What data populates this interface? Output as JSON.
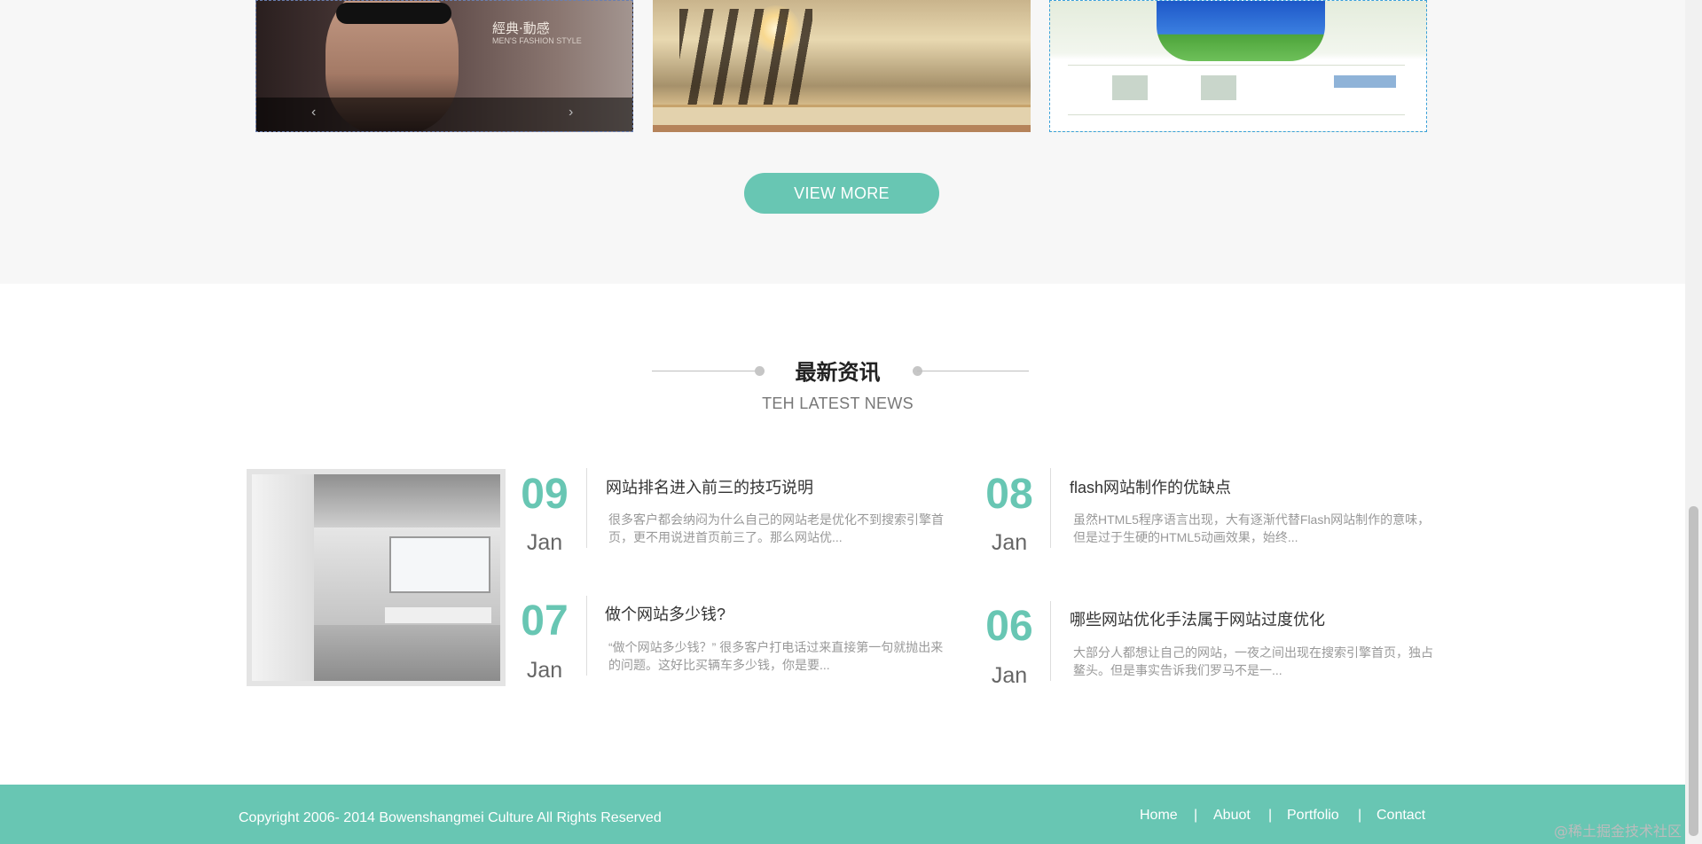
{
  "portfolio": {
    "thumb1_slogan_cn": "經典·動感",
    "thumb1_slogan_en": "MEN'S FASHION STYLE",
    "view_more_label": "VIEW MORE"
  },
  "news": {
    "title": "最新资讯",
    "subtitle": "TEH LATEST NEWS",
    "items": [
      {
        "day": "09",
        "month": "Jan",
        "title": "网站排名进入前三的技巧说明",
        "summary": "很多客户都会纳闷为什么自己的网站老是优化不到搜索引擎首页，更不用说进首页前三了。那么网站优..."
      },
      {
        "day": "08",
        "month": "Jan",
        "title": "flash网站制作的优缺点",
        "summary": "虽然HTML5程序语言出现，大有逐渐代替Flash网站制作的意味，但是过于生硬的HTML5动画效果，始终..."
      },
      {
        "day": "07",
        "month": "Jan",
        "title": "做个网站多少钱?",
        "summary": "“做个网站多少钱？” 很多客户打电话过来直接第一句就抛出来的问题。这好比买辆车多少钱，你是要..."
      },
      {
        "day": "06",
        "month": "Jan",
        "title": "哪些网站优化手法属于网站过度优化",
        "summary": "大部分人都想让自己的网站，一夜之间出现在搜索引擎首页，独占鳌头。但是事实告诉我们罗马不是一..."
      }
    ]
  },
  "footer": {
    "copyright": "Copyright 2006- 2014 Bowenshangmei Culture All Rights Reserved",
    "nav": [
      "Home",
      "Abuot",
      "Portfolio",
      "Contact"
    ],
    "separator": "|"
  },
  "watermark": "@稀土掘金技术社区",
  "colors": {
    "accent": "#68c6b3",
    "footer_bg": "#68c6b3",
    "band_bg": "#f7f7f7"
  }
}
